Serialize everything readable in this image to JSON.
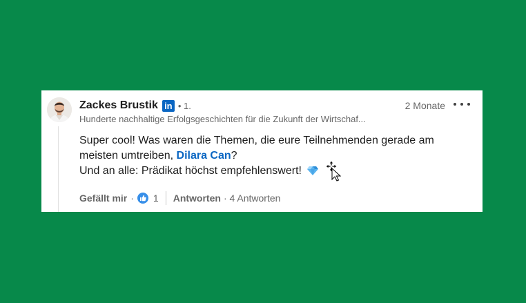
{
  "comment": {
    "author": "Zackes Brustik",
    "badge": "in",
    "degree": "• 1.",
    "headline": "Hunderte nachhaltige Erfolgsgeschichten für die Zukunft der Wirtschaf...",
    "time": "2 Monate",
    "body_line1": "Super cool! Was waren die Themen, die eure Teilnehmenden gerade am meisten umtreiben, ",
    "mention": "Dilara Can",
    "body_after_mention": "?",
    "body_line2": "Und an alle: Prädikat höchst empfehlenswert!"
  },
  "actions": {
    "like_label": "Gefällt mir",
    "separator": "·",
    "reaction_count": "1",
    "reply_label": "Antworten",
    "reply_count": "· 4 Antworten"
  },
  "colors": {
    "background": "#07894a",
    "link": "#0a66c2",
    "like": "#378fe9"
  },
  "icons": {
    "more": "ellipsis-icon",
    "gem": "gem-emoji-icon",
    "like": "thumbs-up-icon",
    "cursor": "move-cursor-icon"
  }
}
